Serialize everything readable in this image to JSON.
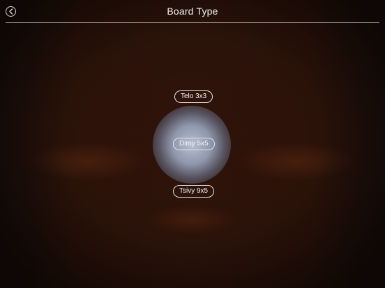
{
  "header": {
    "title": "Board Type",
    "back_icon": "chevron-left-circle-icon"
  },
  "options": [
    {
      "label": "Telo 3x3",
      "selected": false
    },
    {
      "label": "Dimy 5x5",
      "selected": true
    },
    {
      "label": "Tsivy 9x5",
      "selected": false
    }
  ],
  "colors": {
    "background": "#2b130a",
    "text": "#f2f2f2",
    "selection_glow": "#b4c0d8"
  }
}
